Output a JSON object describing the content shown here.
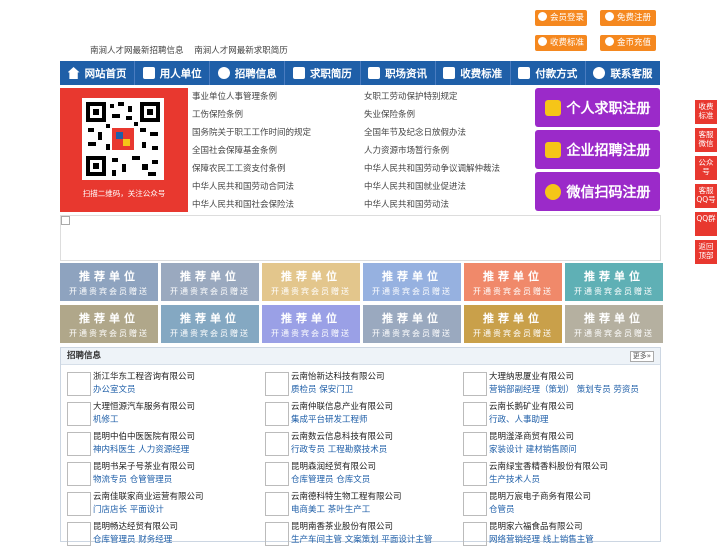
{
  "top_buttons": {
    "member_login": "会员登录",
    "free_register": "免费注册",
    "fee_standard": "收费标准",
    "gold_recharge": "金币充值"
  },
  "top_links": [
    "南涧人才网最新招聘信息",
    "南涧人才网最新求职简历"
  ],
  "nav": [
    "网站首页",
    "用人单位",
    "招聘信息",
    "求职简历",
    "职场资讯",
    "收费标准",
    "付款方式",
    "联系客服"
  ],
  "qr_caption": "扫描二维码，关注公众号",
  "laws_left": [
    "事业单位人事管理条例",
    "工伤保险条例",
    "国务院关于职工工作时间的规定",
    "全国社会保障基金条例",
    "保障农民工工资支付条例",
    "中华人民共和国劳动合同法",
    "中华人民共和国社会保险法"
  ],
  "laws_right": [
    "女职工劳动保护特别规定",
    "失业保险条例",
    "全国年节及纪念日放假办法",
    "人力资源市场暂行条例",
    "中华人民共和国劳动争议调解仲裁法",
    "中华人民共和国就业促进法",
    "中华人民共和国劳动法"
  ],
  "register": {
    "personal": "个人求职注册",
    "company": "企业招聘注册",
    "wechat": "微信扫码注册"
  },
  "tiles": {
    "title": "推荐单位",
    "subtitle": "开通贵宾会员赠送",
    "colors": [
      "#8ea3bf",
      "#9aa9bf",
      "#e3c68c",
      "#96b1e0",
      "#f0896a",
      "#5fb0b5",
      "#b0a78a",
      "#84a8c2",
      "#9aa0e6",
      "#9aa9bf",
      "#c9a04a",
      "#b5b0a0"
    ]
  },
  "jobs_section": {
    "title": "招聘信息",
    "more": "更多»",
    "columns": [
      [
        {
          "company": "浙江华东工程咨询有限公司",
          "positions": "办公室文员"
        },
        {
          "company": "大理恒源汽车服务有限公司",
          "positions": "机修工"
        },
        {
          "company": "昆明中伯中医医院有限公司",
          "positions": "神内科医生  人力资源经理"
        },
        {
          "company": "昆明书呆子号茶业有限公司",
          "positions": "物流专员  仓管管理员"
        },
        {
          "company": "云南佳联家商业运营有限公司",
          "positions": "门店店长  平面设计"
        },
        {
          "company": "昆明畅达经贸有限公司",
          "positions": "仓库管理员  财务经理"
        }
      ],
      [
        {
          "company": "云南怡新达科技有限公司",
          "positions": "质检员  保安门卫"
        },
        {
          "company": "云南仲联信息产业有限公司",
          "positions": "集成平台研发工程师"
        },
        {
          "company": "云南数云信息科技有限公司",
          "positions": "行政专员  工程勘察技术员"
        },
        {
          "company": "昆明森润经贸有限公司",
          "positions": "仓库管理员  仓库文员"
        },
        {
          "company": "云南德科特生物工程有限公司",
          "positions": "电商美工  茶叶生产工"
        },
        {
          "company": "昆明南香茶业股份有限公司",
          "positions": "生产车间主管  文案策划  平面设计主管"
        }
      ],
      [
        {
          "company": "大理纳思厦业有限公司",
          "positions": "营销部副经理（策划）  策划专员  劳资员"
        },
        {
          "company": "云南长鹅矿业有限公司",
          "positions": "行政、人事助理"
        },
        {
          "company": "昆明滏泽商贸有限公司",
          "positions": "家装设计  建材销售顾问"
        },
        {
          "company": "云南绿宝香精香料股份有限公司",
          "positions": "生产技术人员"
        },
        {
          "company": "昆明万宸电子商务有限公司",
          "positions": "仓管员"
        },
        {
          "company": "昆明家六福食品有限公司",
          "positions": "网络营销经理  线上销售主管"
        }
      ]
    ]
  },
  "side_float": [
    "收费标准",
    "客服微信",
    "公众号",
    "客服QQ号",
    "QQ群",
    "返回顶部"
  ]
}
